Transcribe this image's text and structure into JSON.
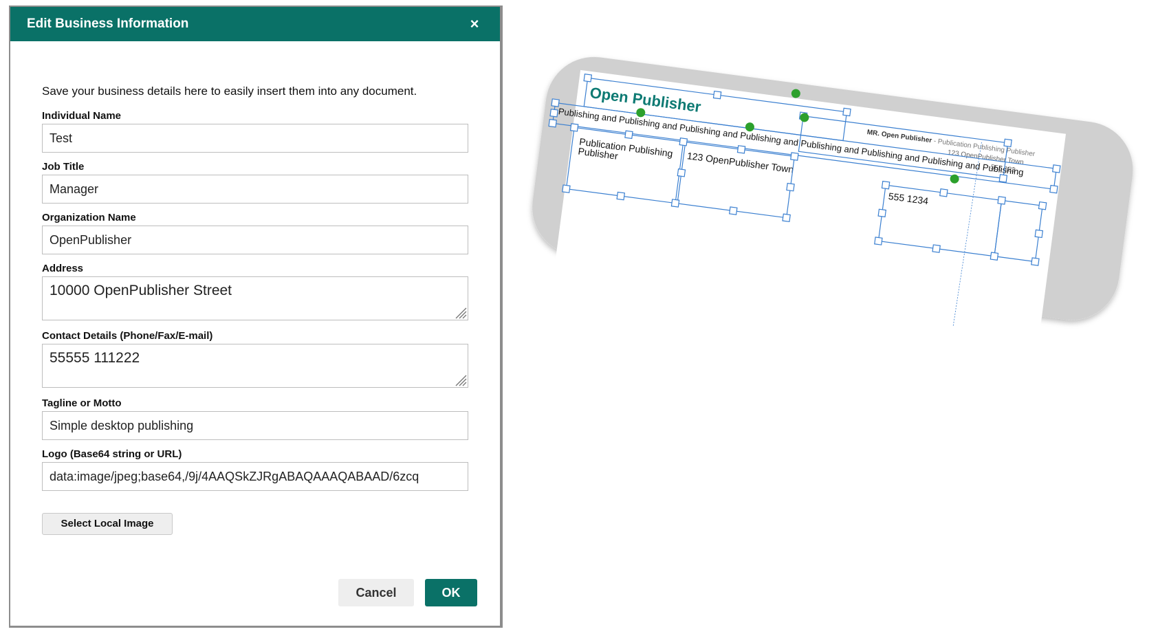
{
  "dialog": {
    "title": "Edit Business Information",
    "close_symbol": "×",
    "intro": "Save your business details here to easily insert them into any document.",
    "fields": {
      "individual_name": {
        "label": "Individual Name",
        "value": "Test"
      },
      "job_title": {
        "label": "Job Title",
        "value": "Manager"
      },
      "organization_name": {
        "label": "Organization Name",
        "value": "OpenPublisher"
      },
      "address": {
        "label": "Address",
        "value": "10000 OpenPublisher Street"
      },
      "contact_details": {
        "label": "Contact Details (Phone/Fax/E-mail)",
        "value": "55555 111222"
      },
      "tagline": {
        "label": "Tagline or Motto",
        "value": "Simple desktop publishing"
      },
      "logo": {
        "label": "Logo (Base64 string or URL)",
        "value": "data:image/jpeg;base64,/9j/4AAQSkZJRgABAQAAAQABAAD/6zcq"
      }
    },
    "select_local_image_label": "Select Local Image",
    "cancel_label": "Cancel",
    "ok_label": "OK",
    "accent_color": "#0a7167"
  },
  "preview": {
    "company": "Open Publisher",
    "header_right_bold": "MR. Open Publisher",
    "header_right_rest": " - Publication Publishing Publisher",
    "header_right_line2": "123 OpenPublisher Town",
    "header_right_line3": "555 123",
    "tagline_row": "Publishing and Publishing and Publishing and Publishing and Publishing and Publishing and Publishing and Publishing",
    "block1_line1": "Publication Publishing",
    "block1_line2": "Publisher",
    "block2": "123 OpenPublisher Town",
    "block3": "555 1234"
  }
}
